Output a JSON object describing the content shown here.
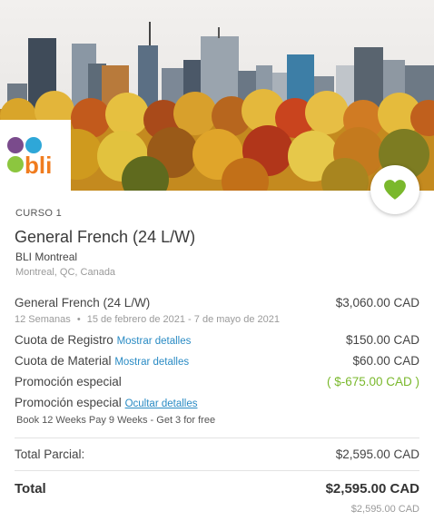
{
  "course": {
    "label": "CURSO 1",
    "title": "General French (24 L/W)",
    "school": "BLI Montreal",
    "location": "Montreal, QC, Canada"
  },
  "logo": {
    "text": "bli"
  },
  "favorite": {
    "icon": "heart-icon",
    "color": "#7ab82c"
  },
  "lines": {
    "tuition": {
      "label": "General French (24 L/W)",
      "amount": "$3,060.00 CAD",
      "duration": "12 Semanas",
      "dates": "15 de febrero de 2021 - 7 de mayo de 2021"
    },
    "registration": {
      "label": "Cuota de Registro",
      "link": "Mostrar detalles",
      "amount": "$150.00 CAD"
    },
    "material": {
      "label": "Cuota de Material",
      "link": "Mostrar detalles",
      "amount": "$60.00 CAD"
    },
    "promotion": {
      "label": "Promoción especial",
      "amount": "( $-675.00 CAD )"
    },
    "promotion_details": {
      "label": "Promoción especial",
      "link": "Ocultar detalles",
      "description": "Book 12 Weeks Pay 9 Weeks - Get 3 for free"
    }
  },
  "subtotal": {
    "label": "Total Parcial:",
    "amount": "$2,595.00 CAD"
  },
  "total": {
    "label": "Total",
    "amount": "$2,595.00 CAD",
    "secondary_amount": "$2,595.00 CAD"
  },
  "colors": {
    "accent_green": "#7ab82c",
    "link_blue": "#2a8bc4"
  }
}
